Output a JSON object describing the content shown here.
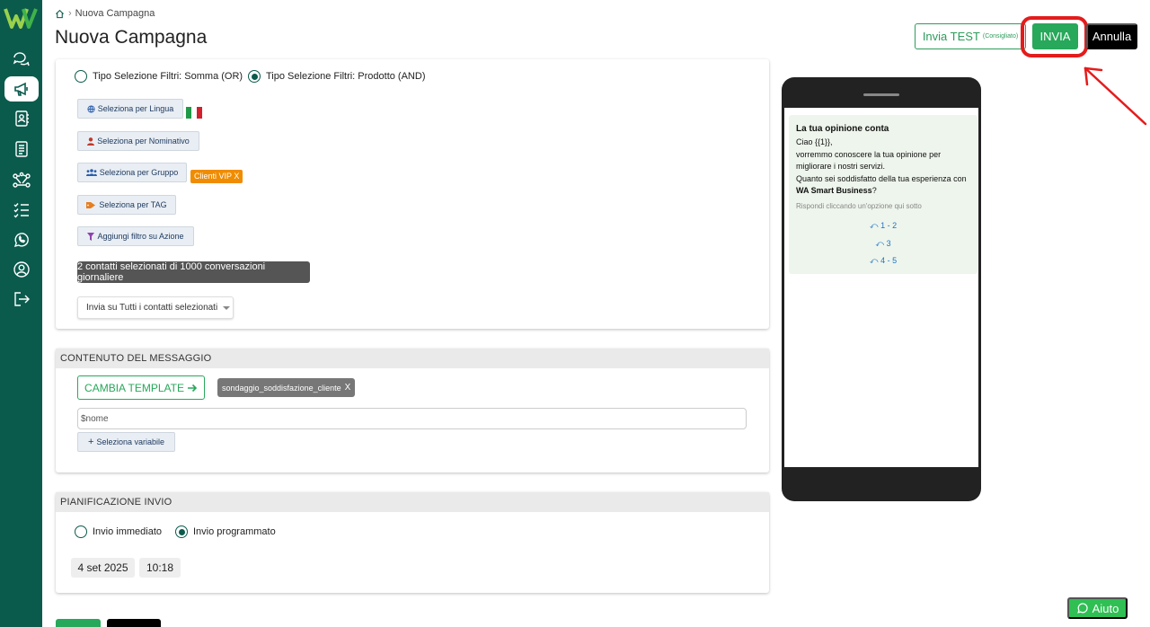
{
  "app": {
    "accent": "#0b5b4d",
    "green": "#27a85a",
    "annotation_color": "#e41c1c"
  },
  "sidebar": {
    "items": [
      {
        "icon": "chat-bubbles-icon"
      },
      {
        "icon": "megaphone-icon",
        "active": true
      },
      {
        "icon": "contacts-book-icon"
      },
      {
        "icon": "document-icon"
      },
      {
        "icon": "flow-network-icon"
      },
      {
        "icon": "checklist-icon"
      },
      {
        "icon": "whatsapp-icon"
      },
      {
        "icon": "user-circle-icon"
      },
      {
        "icon": "logout-icon"
      }
    ]
  },
  "header": {
    "breadcrumb": "Nuova Campagna",
    "title": "Nuova Campagna",
    "test_label": "Invia TEST",
    "test_note": "(Consigliato)",
    "send_label": "INVIA",
    "cancel_label": "Annulla"
  },
  "filters": {
    "type_or": "Tipo Selezione Filtri: Somma (OR)",
    "type_and": "Tipo Selezione Filtri: Prodotto (AND)",
    "selected_type": "and",
    "by_language": "Seleziona per Lingua",
    "by_name": "Seleziona per Nominativo",
    "by_group": "Seleziona per Gruppo",
    "group_tag": "Clienti VIP X",
    "by_tag": "Seleziona per TAG",
    "by_action": "Aggiungi filtro su Azione",
    "selected_info": "2 contatti selezionati di 1000 conversazioni giornaliere",
    "send_scope": "Invia su Tutti i contatti selezionati"
  },
  "message": {
    "section_title": "CONTENUTO DEL MESSAGGIO",
    "change_template": "CAMBIA TEMPLATE",
    "template_name": "sondaggio_soddisfazione_cliente",
    "template_remove": "X",
    "variable_placeholder": "$nome",
    "select_variable": "Seleziona variabile"
  },
  "schedule": {
    "section_title": "PIANIFICAZIONE INVIO",
    "immediate": "Invio immediato",
    "scheduled": "Invio programmato",
    "selected": "scheduled",
    "date": "4 set 2025",
    "time": "10:18"
  },
  "preview": {
    "title": "La tua opinione conta",
    "line1": "Ciao {{1}},",
    "line2": "vorremmo conoscere la tua opinione per migliorare i nostri servizi.",
    "line3": "Quanto sei soddisfatto della tua esperienza con",
    "brand": "WA Smart Business",
    "question_mark": "?",
    "hint": "Rispondi cliccando un'opzione qui sotto",
    "options": [
      "1 - 2",
      "3",
      "4 - 5"
    ]
  },
  "help": {
    "label": "Aiuto"
  }
}
